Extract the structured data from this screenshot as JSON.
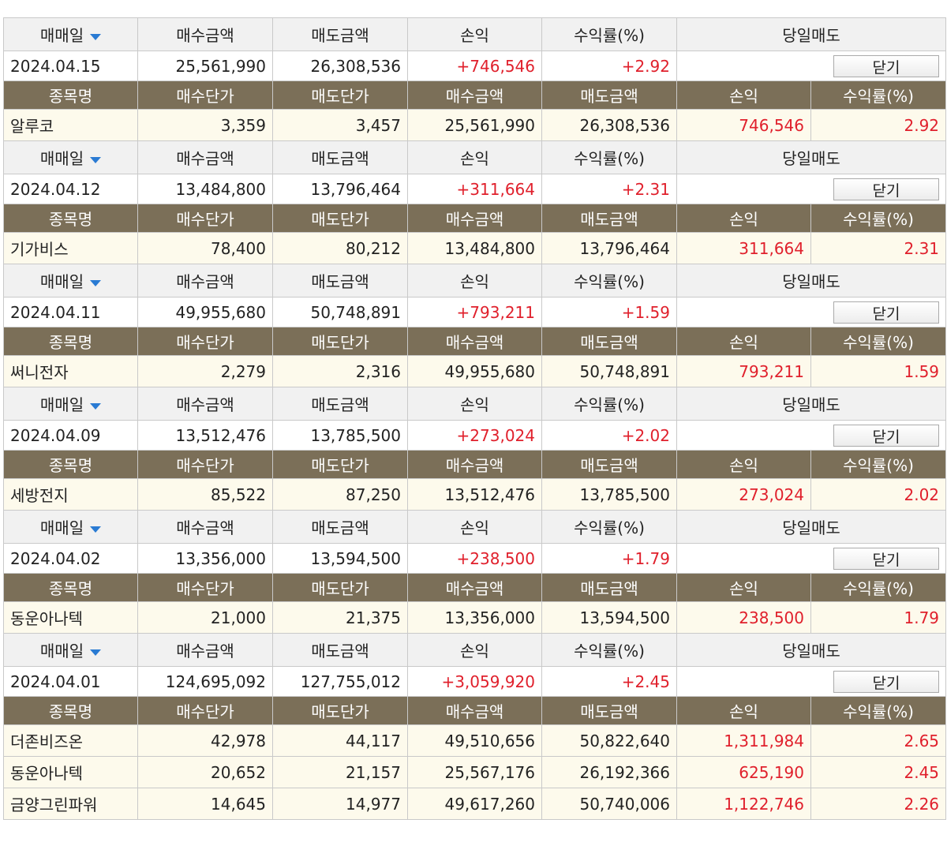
{
  "headers": {
    "summary": [
      "매매일",
      "매수금액",
      "매도금액",
      "손익",
      "수익률(%)",
      "당일매도"
    ],
    "item": [
      "종목명",
      "매수단가",
      "매도단가",
      "매수금액",
      "매도금액",
      "손익",
      "수익률(%)"
    ]
  },
  "close_label": "닫기",
  "groups": [
    {
      "date": "2024.04.15",
      "buy_amount": "25,561,990",
      "sell_amount": "26,308,536",
      "pnl": "+746,546",
      "return_pct": "+2.92",
      "items": [
        {
          "name": "알루코",
          "buy_price": "3,359",
          "sell_price": "3,457",
          "buy_amount": "25,561,990",
          "sell_amount": "26,308,536",
          "pnl": "746,546",
          "return_pct": "2.92"
        }
      ]
    },
    {
      "date": "2024.04.12",
      "buy_amount": "13,484,800",
      "sell_amount": "13,796,464",
      "pnl": "+311,664",
      "return_pct": "+2.31",
      "items": [
        {
          "name": "기가비스",
          "buy_price": "78,400",
          "sell_price": "80,212",
          "buy_amount": "13,484,800",
          "sell_amount": "13,796,464",
          "pnl": "311,664",
          "return_pct": "2.31"
        }
      ]
    },
    {
      "date": "2024.04.11",
      "buy_amount": "49,955,680",
      "sell_amount": "50,748,891",
      "pnl": "+793,211",
      "return_pct": "+1.59",
      "items": [
        {
          "name": "써니전자",
          "buy_price": "2,279",
          "sell_price": "2,316",
          "buy_amount": "49,955,680",
          "sell_amount": "50,748,891",
          "pnl": "793,211",
          "return_pct": "1.59"
        }
      ]
    },
    {
      "date": "2024.04.09",
      "buy_amount": "13,512,476",
      "sell_amount": "13,785,500",
      "pnl": "+273,024",
      "return_pct": "+2.02",
      "items": [
        {
          "name": "세방전지",
          "buy_price": "85,522",
          "sell_price": "87,250",
          "buy_amount": "13,512,476",
          "sell_amount": "13,785,500",
          "pnl": "273,024",
          "return_pct": "2.02"
        }
      ]
    },
    {
      "date": "2024.04.02",
      "buy_amount": "13,356,000",
      "sell_amount": "13,594,500",
      "pnl": "+238,500",
      "return_pct": "+1.79",
      "items": [
        {
          "name": "동운아나텍",
          "buy_price": "21,000",
          "sell_price": "21,375",
          "buy_amount": "13,356,000",
          "sell_amount": "13,594,500",
          "pnl": "238,500",
          "return_pct": "1.79"
        }
      ]
    },
    {
      "date": "2024.04.01",
      "buy_amount": "124,695,092",
      "sell_amount": "127,755,012",
      "pnl": "+3,059,920",
      "return_pct": "+2.45",
      "items": [
        {
          "name": "더존비즈온",
          "buy_price": "42,978",
          "sell_price": "44,117",
          "buy_amount": "49,510,656",
          "sell_amount": "50,822,640",
          "pnl": "1,311,984",
          "return_pct": "2.65"
        },
        {
          "name": "동운아나텍",
          "buy_price": "20,652",
          "sell_price": "21,157",
          "buy_amount": "25,567,176",
          "sell_amount": "26,192,366",
          "pnl": "625,190",
          "return_pct": "2.45"
        },
        {
          "name": "금양그린파워",
          "buy_price": "14,645",
          "sell_price": "14,977",
          "buy_amount": "49,617,260",
          "sell_amount": "50,740,006",
          "pnl": "1,122,746",
          "return_pct": "2.26"
        }
      ]
    }
  ],
  "colors": {
    "accent_red": "#e0202c",
    "header_brown": "#7b6f58",
    "row_cream": "#fdfaec",
    "caret_blue": "#2a7bd3"
  }
}
